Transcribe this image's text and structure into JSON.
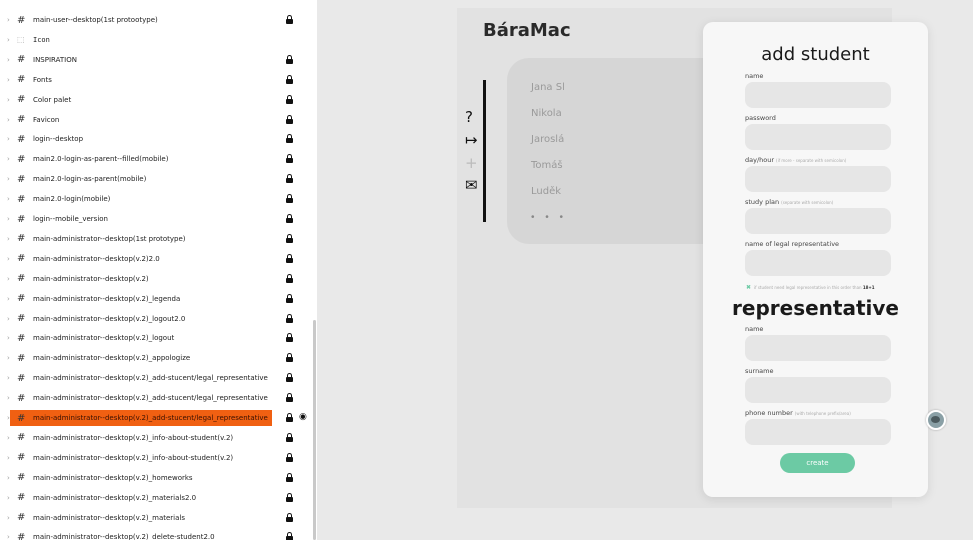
{
  "layers": [
    {
      "kind": "#",
      "name": "main-user--desktop(1st protootype)",
      "locked": true
    },
    {
      "kind": "box",
      "name": "Icon",
      "locked": false
    },
    {
      "kind": "#",
      "name": "INSPIRATION",
      "locked": true
    },
    {
      "kind": "#",
      "name": "Fonts",
      "locked": true
    },
    {
      "kind": "#",
      "name": "Color palet",
      "locked": true
    },
    {
      "kind": "#",
      "name": "Favicon",
      "locked": true
    },
    {
      "kind": "#",
      "name": "login--desktop",
      "locked": true
    },
    {
      "kind": "#",
      "name": "main2.0-login-as-parent--filled(mobile)",
      "locked": true
    },
    {
      "kind": "#",
      "name": "main2.0-login-as-parent(mobile)",
      "locked": true
    },
    {
      "kind": "#",
      "name": "main2.0-login(mobile)",
      "locked": true
    },
    {
      "kind": "#",
      "name": "login--mobile_version",
      "locked": true
    },
    {
      "kind": "#",
      "name": "main-administrator--desktop(1st prototype)",
      "locked": true
    },
    {
      "kind": "#",
      "name": "main-administrator--desktop(v.2)2.0",
      "locked": true
    },
    {
      "kind": "#",
      "name": "main-administrator--desktop(v.2)",
      "locked": true
    },
    {
      "kind": "#",
      "name": "main-administrator--desktop(v.2)_legenda",
      "locked": true
    },
    {
      "kind": "#",
      "name": "main-administrator--desktop(v.2)_logout2.0",
      "locked": true
    },
    {
      "kind": "#",
      "name": "main-administrator--desktop(v.2)_logout",
      "locked": true
    },
    {
      "kind": "#",
      "name": "main-administrator--desktop(v.2)_appologize",
      "locked": true
    },
    {
      "kind": "#",
      "name": "main-administrator--desktop(v.2)_add-stucent/legal_representative",
      "locked": true
    },
    {
      "kind": "#",
      "name": "main-administrator--desktop(v.2)_add-stucent/legal_representative",
      "locked": true
    },
    {
      "kind": "#",
      "name": "main-administrator--desktop(v.2)_add-stucent/legal_representative",
      "locked": true,
      "selected": true
    },
    {
      "kind": "#",
      "name": "main-administrator--desktop(v.2)_info-about-student(v.2)",
      "locked": true
    },
    {
      "kind": "#",
      "name": "main-administrator--desktop(v.2)_info-about-student(v.2)",
      "locked": true
    },
    {
      "kind": "#",
      "name": "main-administrator--desktop(v.2)_homeworks",
      "locked": true
    },
    {
      "kind": "#",
      "name": "main-administrator--desktop(v.2)_materials2.0",
      "locked": true
    },
    {
      "kind": "#",
      "name": "main-administrator--desktop(v.2)_materials",
      "locked": true
    },
    {
      "kind": "#",
      "name": "main-administrator--desktop(v.2)_delete-student2.0",
      "locked": true
    }
  ],
  "artboard": {
    "brand": "BáraMac",
    "side_icons": [
      {
        "glyph": "?",
        "name": "help-icon"
      },
      {
        "glyph": "↦",
        "name": "logout-icon"
      },
      {
        "glyph": "+",
        "name": "add-icon"
      },
      {
        "glyph": "✉",
        "name": "mail-icon"
      }
    ],
    "students": [
      "Jana Sl",
      "Nikola",
      "Jaroslá",
      "Tomáš",
      "Luděk"
    ],
    "more": "• • •"
  },
  "modal": {
    "title": "add student",
    "fields_top": [
      {
        "label": "name",
        "hint": ""
      },
      {
        "label": "password",
        "hint": ""
      },
      {
        "label": "day/hour",
        "hint": "(if more - separate with semicolon)"
      },
      {
        "label": "study plan",
        "hint": "(separate with semicolon)"
      },
      {
        "label": "name of legal representative",
        "hint": ""
      }
    ],
    "checkbox_text": "if student need legal representative in this order than",
    "checkbox_emph": "18+1",
    "section_title": "representative",
    "fields_bottom": [
      {
        "label": "name",
        "hint": ""
      },
      {
        "label": "surname",
        "hint": ""
      },
      {
        "label": "phone number",
        "hint": "(with telephone prefix/area)"
      }
    ],
    "create_label": "create"
  },
  "colors": {
    "selection": "#f06012",
    "accent": "#6ccaa4"
  }
}
